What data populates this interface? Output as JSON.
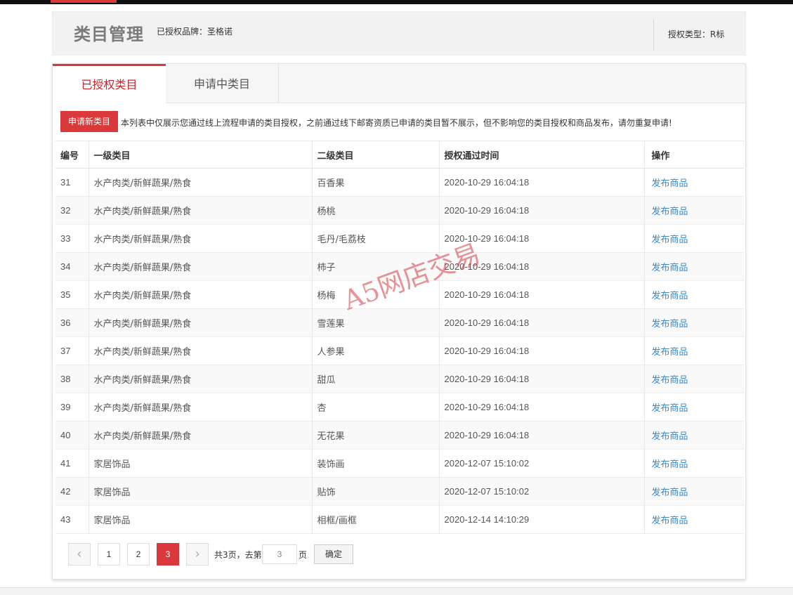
{
  "header": {
    "title": "类目管理",
    "brand_label": "已授权品牌：圣格诺",
    "auth_type_label": "授权类型：R标"
  },
  "tabs": [
    {
      "label": "已授权类目",
      "active": true
    },
    {
      "label": "申请中类目",
      "active": false
    }
  ],
  "notice": {
    "apply_button": "申请新类目",
    "text": "本列表中仅展示您通过线上流程申请的类目授权，之前通过线下邮寄资质已申请的类目暂不展示，但不影响您的类目授权和商品发布，请勿重复申请!"
  },
  "table": {
    "columns": [
      "编号",
      "一级类目",
      "二级类目",
      "授权通过时间",
      "操作"
    ],
    "rows": [
      {
        "id": "31",
        "level1": "水产肉类/新鲜蔬果/熟食",
        "level2": "百香果",
        "time": "2020-10-29 16:04:18",
        "action": "发布商品"
      },
      {
        "id": "32",
        "level1": "水产肉类/新鲜蔬果/熟食",
        "level2": "杨桃",
        "time": "2020-10-29 16:04:18",
        "action": "发布商品"
      },
      {
        "id": "33",
        "level1": "水产肉类/新鲜蔬果/熟食",
        "level2": "毛丹/毛荔枝",
        "time": "2020-10-29 16:04:18",
        "action": "发布商品"
      },
      {
        "id": "34",
        "level1": "水产肉类/新鲜蔬果/熟食",
        "level2": "柿子",
        "time": "2020-10-29 16:04:18",
        "action": "发布商品"
      },
      {
        "id": "35",
        "level1": "水产肉类/新鲜蔬果/熟食",
        "level2": "杨梅",
        "time": "2020-10-29 16:04:18",
        "action": "发布商品"
      },
      {
        "id": "36",
        "level1": "水产肉类/新鲜蔬果/熟食",
        "level2": "雪莲果",
        "time": "2020-10-29 16:04:18",
        "action": "发布商品"
      },
      {
        "id": "37",
        "level1": "水产肉类/新鲜蔬果/熟食",
        "level2": "人参果",
        "time": "2020-10-29 16:04:18",
        "action": "发布商品"
      },
      {
        "id": "38",
        "level1": "水产肉类/新鲜蔬果/熟食",
        "level2": "甜瓜",
        "time": "2020-10-29 16:04:18",
        "action": "发布商品"
      },
      {
        "id": "39",
        "level1": "水产肉类/新鲜蔬果/熟食",
        "level2": "杏",
        "time": "2020-10-29 16:04:18",
        "action": "发布商品"
      },
      {
        "id": "40",
        "level1": "水产肉类/新鲜蔬果/熟食",
        "level2": "无花果",
        "time": "2020-10-29 16:04:18",
        "action": "发布商品"
      },
      {
        "id": "41",
        "level1": "家居饰品",
        "level2": "装饰画",
        "time": "2020-12-07 15:10:02",
        "action": "发布商品"
      },
      {
        "id": "42",
        "level1": "家居饰品",
        "level2": "贴饰",
        "time": "2020-12-07 15:10:02",
        "action": "发布商品"
      },
      {
        "id": "43",
        "level1": "家居饰品",
        "level2": "相框/画框",
        "time": "2020-12-14 14:10:29",
        "action": "发布商品"
      }
    ]
  },
  "pagination": {
    "prev_icon": "chevron-left-icon",
    "next_icon": "chevron-right-icon",
    "pages": [
      "1",
      "2",
      "3"
    ],
    "current_page": "3",
    "total_text": "共3页，去第",
    "page_suffix": "页",
    "goto_value": "3",
    "confirm_label": "确定"
  },
  "watermark": "A5网店交易",
  "colors": {
    "accent": "#d9393a",
    "link": "#3a87c8"
  }
}
